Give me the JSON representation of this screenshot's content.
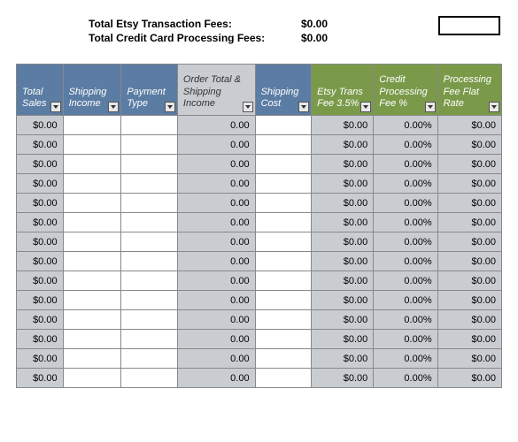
{
  "summary": {
    "etsy_label": "Total Etsy Transaction Fees:",
    "etsy_value": "$0.00",
    "cc_label": "Total Credit Card Processing Fees:",
    "cc_value": "$0.00"
  },
  "headers": {
    "total_sales": "Total Sales",
    "shipping_income": "Shipping Income",
    "payment_type": "Payment Type",
    "order_total": "Order Total & Shipping Income",
    "shipping_cost": "Shipping Cost",
    "etsy_fee": "Etsy Trans Fee 3.5%",
    "cc_pct": "Credit Processing Fee %",
    "cc_flat": "Processing Fee Flat Rate"
  },
  "rows": [
    {
      "sales": "$0.00",
      "shipinc": "",
      "paytype": "",
      "ordertot": "0.00",
      "shipcost": "",
      "etsy": "$0.00",
      "ccpct": "0.00%",
      "ccflat": "$0.00"
    },
    {
      "sales": "$0.00",
      "shipinc": "",
      "paytype": "",
      "ordertot": "0.00",
      "shipcost": "",
      "etsy": "$0.00",
      "ccpct": "0.00%",
      "ccflat": "$0.00"
    },
    {
      "sales": "$0.00",
      "shipinc": "",
      "paytype": "",
      "ordertot": "0.00",
      "shipcost": "",
      "etsy": "$0.00",
      "ccpct": "0.00%",
      "ccflat": "$0.00"
    },
    {
      "sales": "$0.00",
      "shipinc": "",
      "paytype": "",
      "ordertot": "0.00",
      "shipcost": "",
      "etsy": "$0.00",
      "ccpct": "0.00%",
      "ccflat": "$0.00"
    },
    {
      "sales": "$0.00",
      "shipinc": "",
      "paytype": "",
      "ordertot": "0.00",
      "shipcost": "",
      "etsy": "$0.00",
      "ccpct": "0.00%",
      "ccflat": "$0.00"
    },
    {
      "sales": "$0.00",
      "shipinc": "",
      "paytype": "",
      "ordertot": "0.00",
      "shipcost": "",
      "etsy": "$0.00",
      "ccpct": "0.00%",
      "ccflat": "$0.00"
    },
    {
      "sales": "$0.00",
      "shipinc": "",
      "paytype": "",
      "ordertot": "0.00",
      "shipcost": "",
      "etsy": "$0.00",
      "ccpct": "0.00%",
      "ccflat": "$0.00"
    },
    {
      "sales": "$0.00",
      "shipinc": "",
      "paytype": "",
      "ordertot": "0.00",
      "shipcost": "",
      "etsy": "$0.00",
      "ccpct": "0.00%",
      "ccflat": "$0.00"
    },
    {
      "sales": "$0.00",
      "shipinc": "",
      "paytype": "",
      "ordertot": "0.00",
      "shipcost": "",
      "etsy": "$0.00",
      "ccpct": "0.00%",
      "ccflat": "$0.00"
    },
    {
      "sales": "$0.00",
      "shipinc": "",
      "paytype": "",
      "ordertot": "0.00",
      "shipcost": "",
      "etsy": "$0.00",
      "ccpct": "0.00%",
      "ccflat": "$0.00"
    },
    {
      "sales": "$0.00",
      "shipinc": "",
      "paytype": "",
      "ordertot": "0.00",
      "shipcost": "",
      "etsy": "$0.00",
      "ccpct": "0.00%",
      "ccflat": "$0.00"
    },
    {
      "sales": "$0.00",
      "shipinc": "",
      "paytype": "",
      "ordertot": "0.00",
      "shipcost": "",
      "etsy": "$0.00",
      "ccpct": "0.00%",
      "ccflat": "$0.00"
    },
    {
      "sales": "$0.00",
      "shipinc": "",
      "paytype": "",
      "ordertot": "0.00",
      "shipcost": "",
      "etsy": "$0.00",
      "ccpct": "0.00%",
      "ccflat": "$0.00"
    },
    {
      "sales": "$0.00",
      "shipinc": "",
      "paytype": "",
      "ordertot": "0.00",
      "shipcost": "",
      "etsy": "$0.00",
      "ccpct": "0.00%",
      "ccflat": "$0.00"
    }
  ]
}
